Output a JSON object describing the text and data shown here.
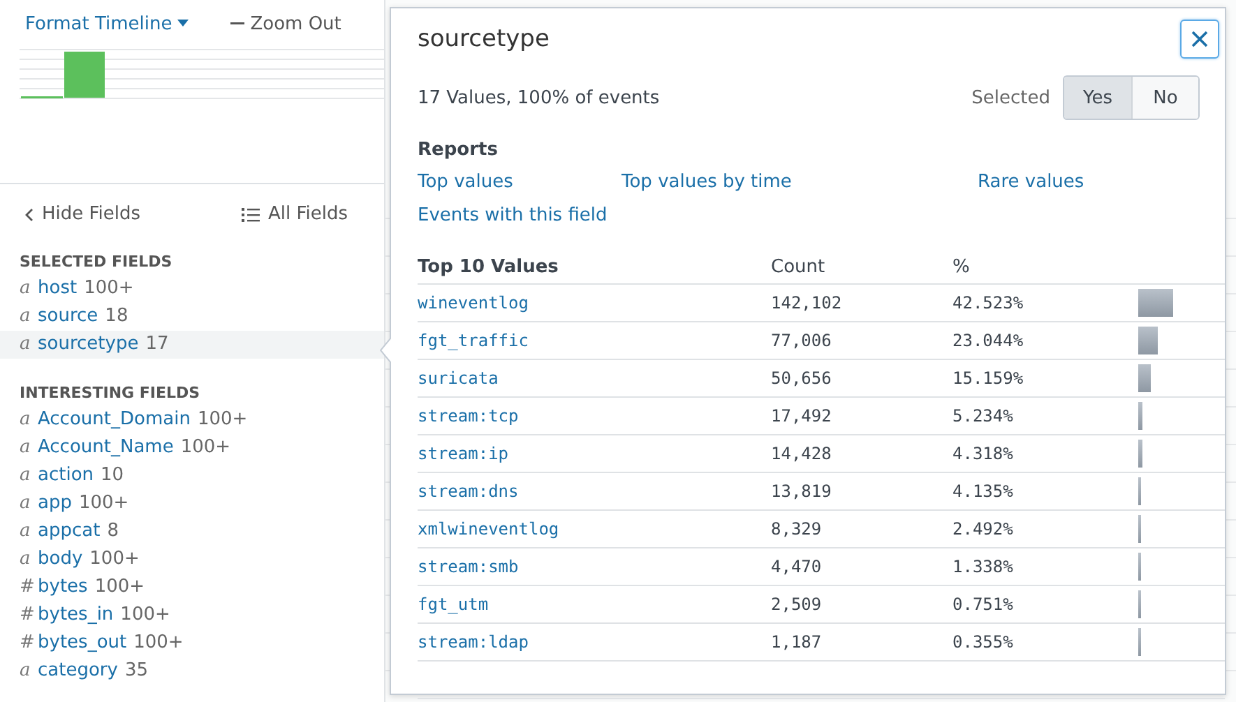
{
  "toolbar": {
    "format_timeline": "Format Timeline",
    "zoom_out": "Zoom Out"
  },
  "fields_bar": {
    "hide": "Hide Fields",
    "all": "All Fields"
  },
  "selected_fields": {
    "heading": "SELECTED FIELDS",
    "items": [
      {
        "type": "a",
        "name": "host",
        "count": "100+",
        "selected": false
      },
      {
        "type": "a",
        "name": "source",
        "count": "18",
        "selected": false
      },
      {
        "type": "a",
        "name": "sourcetype",
        "count": "17",
        "selected": true
      }
    ]
  },
  "interesting_fields": {
    "heading": "INTERESTING FIELDS",
    "items": [
      {
        "type": "a",
        "name": "Account_Domain",
        "count": "100+"
      },
      {
        "type": "a",
        "name": "Account_Name",
        "count": "100+"
      },
      {
        "type": "a",
        "name": "action",
        "count": "10"
      },
      {
        "type": "a",
        "name": "app",
        "count": "100+"
      },
      {
        "type": "a",
        "name": "appcat",
        "count": "8"
      },
      {
        "type": "a",
        "name": "body",
        "count": "100+"
      },
      {
        "type": "#",
        "name": "bytes",
        "count": "100+"
      },
      {
        "type": "#",
        "name": "bytes_in",
        "count": "100+"
      },
      {
        "type": "#",
        "name": "bytes_out",
        "count": "100+"
      },
      {
        "type": "a",
        "name": "category",
        "count": "35"
      }
    ]
  },
  "popup": {
    "title": "sourcetype",
    "summary": "17 Values, 100% of events",
    "selected_label": "Selected",
    "toggle": [
      {
        "label": "Yes",
        "selected": true
      },
      {
        "label": "No",
        "selected": false
      }
    ],
    "reports_heading": "Reports",
    "reports": [
      "Top values",
      "Top values by time",
      "Rare values",
      "Events with this field"
    ],
    "table": {
      "columns": [
        "Top 10 Values",
        "Count",
        "%"
      ],
      "rows": [
        {
          "value": "wineventlog",
          "count": "142,102",
          "percent": "42.523%",
          "level": 0.425
        },
        {
          "value": "fgt_traffic",
          "count": "77,006",
          "percent": "23.044%",
          "level": 0.23
        },
        {
          "value": "suricata",
          "count": "50,656",
          "percent": "15.159%",
          "level": 0.152
        },
        {
          "value": "stream:tcp",
          "count": "17,492",
          "percent": "5.234%",
          "level": 0.052
        },
        {
          "value": "stream:ip",
          "count": "14,428",
          "percent": "4.318%",
          "level": 0.043
        },
        {
          "value": "stream:dns",
          "count": "13,819",
          "percent": "4.135%",
          "level": 0.041
        },
        {
          "value": "xmlwineventlog",
          "count": "8,329",
          "percent": "2.492%",
          "level": 0.025
        },
        {
          "value": "stream:smb",
          "count": "4,470",
          "percent": "1.338%",
          "level": 0.013
        },
        {
          "value": "fgt_utm",
          "count": "2,509",
          "percent": "0.751%",
          "level": 0.0075
        },
        {
          "value": "stream:ldap",
          "count": "1,187",
          "percent": "0.355%",
          "level": 0.0036
        }
      ]
    }
  }
}
